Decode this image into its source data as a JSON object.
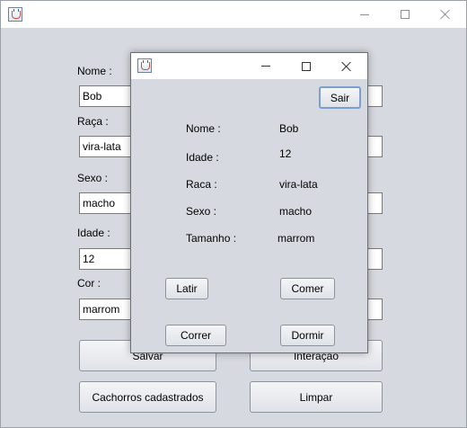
{
  "main_window": {
    "form": {
      "nome_label": "Nome :",
      "nome_value": "Bob",
      "raca_label": "Raça :",
      "raca_value": "vira-lata",
      "sexo_label": "Sexo :",
      "sexo_value": "macho",
      "idade_label": "Idade :",
      "idade_value": "12",
      "cor_label": "Cor :",
      "cor_value": "marrom"
    },
    "buttons": {
      "salvar": "Salvar",
      "interacao": "Interação",
      "cachorros": "Cachorros cadastrados",
      "limpar": "Limpar"
    }
  },
  "dialog": {
    "sair": "Sair",
    "info": {
      "nome_label": "Nome :",
      "nome_value": "Bob",
      "idade_label": "Idade :",
      "idade_value": "12",
      "raca_label": "Raca :",
      "raca_value": "vira-lata",
      "sexo_label": "Sexo :",
      "sexo_value": "macho",
      "tamanho_label": "Tamanho :",
      "tamanho_value": "marrom"
    },
    "actions": {
      "latir": "Latir",
      "comer": "Comer",
      "correr": "Correr",
      "dormir": "Dormir"
    }
  },
  "colors": {
    "window_bg": "#d6d9df",
    "titlebar_bg": "#ffffff",
    "focus_border": "#7b9fcf"
  },
  "icons": {
    "app": "java-cup-icon",
    "minimize": "minimize-icon",
    "maximize": "maximize-icon",
    "close": "close-icon"
  }
}
